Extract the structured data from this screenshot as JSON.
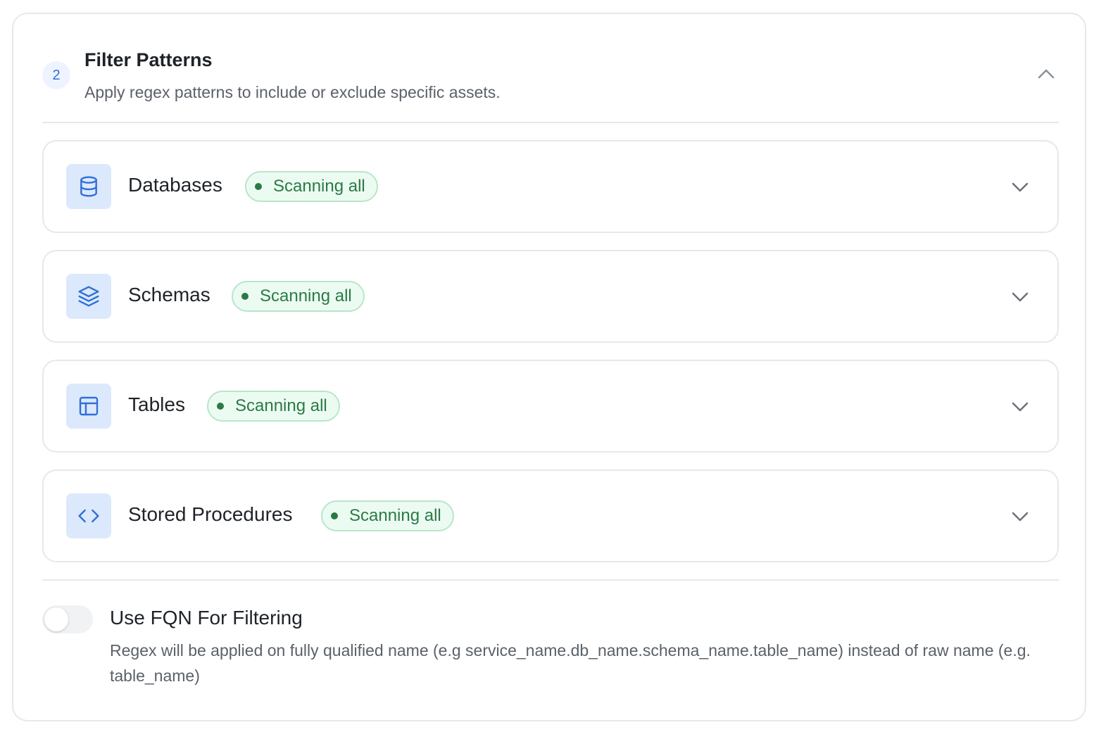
{
  "step": {
    "number": "2",
    "title": "Filter Patterns",
    "description": "Apply regex patterns to include or exclude specific assets."
  },
  "sections": [
    {
      "label": "Databases",
      "status": "Scanning all",
      "icon": "database-icon"
    },
    {
      "label": "Schemas",
      "status": "Scanning all",
      "icon": "layers-icon"
    },
    {
      "label": "Tables",
      "status": "Scanning all",
      "icon": "table-icon"
    },
    {
      "label": "Stored Procedures",
      "status": "Scanning all",
      "icon": "code-icon"
    }
  ],
  "fqn": {
    "label": "Use FQN For Filtering",
    "description": "Regex will be applied on fully qualified name (e.g service_name.db_name.schema_name.table_name) instead of raw name (e.g. table_name)",
    "enabled": false
  },
  "colors": {
    "accent": "#2f6fdb",
    "icon_bg": "#dce9fc",
    "status_green": "#2b7a46",
    "status_bg": "#ecfbf1",
    "border": "#e6e8eb"
  }
}
